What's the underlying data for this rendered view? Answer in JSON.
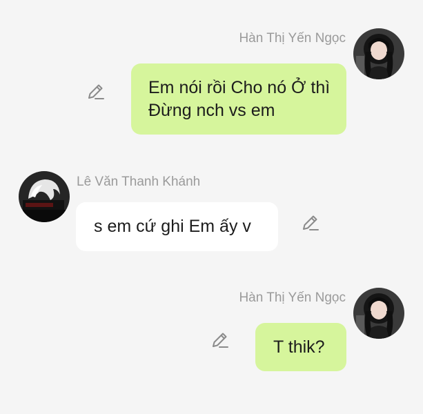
{
  "messages": [
    {
      "sender": "Hàn Thị Yến Ngọc",
      "side": "right",
      "text": "Em nói rồi Cho nó Ở thì Đừng nch vs em",
      "bubble_color": "#d6f59c",
      "avatar": "avatar-girl-dark-hair"
    },
    {
      "sender": "Lê Văn Thanh Khánh",
      "side": "left",
      "text": "s em cứ ghi Em ấy v",
      "bubble_color": "#ffffff",
      "avatar": "avatar-white-hair"
    },
    {
      "sender": "Hàn Thị Yến Ngọc",
      "side": "right",
      "text": "T thik?",
      "bubble_color": "#d6f59c",
      "avatar": "avatar-girl-dark-hair"
    }
  ],
  "icons": {
    "edit": "pencil-icon"
  },
  "colors": {
    "background": "#f5f5f5",
    "sender_name": "#9a9a9a",
    "own_bubble": "#d6f59c",
    "other_bubble": "#ffffff",
    "icon": "#8a8a8a"
  }
}
